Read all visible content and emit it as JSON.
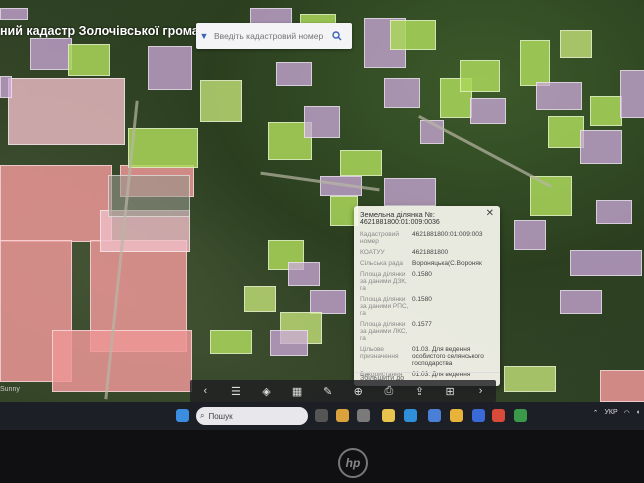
{
  "header": {
    "title": "ний кадастр Золочівської громади"
  },
  "search": {
    "placeholder": "Введіть кадастровий номер або ад"
  },
  "popup": {
    "title": "Земельна ділянка №:",
    "parcel_no": "4621881800:01:009:0036",
    "rows": [
      {
        "k": "Кадастровий номер",
        "v": "4621881800:01:009:003"
      },
      {
        "k": "КОАТУУ",
        "v": "4621881800"
      },
      {
        "k": "Сільська рада",
        "v": "Вороняцька(С.Вороняк"
      },
      {
        "k": "Площа ділянки за даними ДЗК, га",
        "v": "0.1580"
      },
      {
        "k": "Площа ділянки за даними РПС, га",
        "v": "0.1580"
      },
      {
        "k": "Площа ділянки за даними ЛКС, га",
        "v": "0.1577"
      },
      {
        "k": "Цільове призначення",
        "v": "01.03. Для ведення особистого селянського господарства"
      },
      {
        "k": "Використання",
        "v": "01.03. Для ведення"
      }
    ],
    "footer": "Збільшити до"
  },
  "corner": "Sunny",
  "taskbar": {
    "search_label": "Пошук",
    "lang": "УКР"
  }
}
